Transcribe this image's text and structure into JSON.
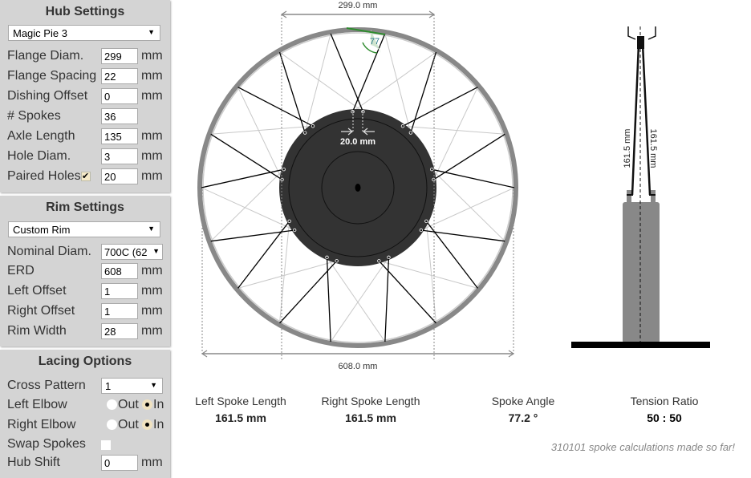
{
  "hub": {
    "title": "Hub Settings",
    "preset": "Magic Pie 3",
    "flange_diam_label": "Flange Diam.",
    "flange_diam": "299",
    "flange_spacing_label": "Flange Spacing",
    "flange_spacing": "22",
    "dishing_label": "Dishing Offset",
    "dishing": "0",
    "spokes_label": "# Spokes",
    "spokes": "36",
    "axle_label": "Axle Length",
    "axle": "135",
    "hole_label": "Hole Diam.",
    "hole": "3",
    "paired_label": "Paired Holes",
    "paired_checked": true,
    "paired": "20",
    "unit": "mm"
  },
  "rim": {
    "title": "Rim Settings",
    "preset": "Custom Rim",
    "nominal_label": "Nominal Diam.",
    "nominal": "700C (62",
    "erd_label": "ERD",
    "erd": "608",
    "left_label": "Left Offset",
    "left": "1",
    "right_label": "Right Offset",
    "right": "1",
    "width_label": "Rim Width",
    "width": "28",
    "unit": "mm"
  },
  "lacing": {
    "title": "Lacing Options",
    "cross_label": "Cross Pattern",
    "cross": "1",
    "left_elbow_label": "Left Elbow",
    "right_elbow_label": "Right Elbow",
    "out": "Out",
    "in": "In",
    "left_elbow": "In",
    "right_elbow": "In",
    "swap_label": "Swap Spokes",
    "swap_checked": false,
    "shift_label": "Hub Shift",
    "shift": "0",
    "unit": "mm"
  },
  "diagram": {
    "flange_dim": "299.0 mm",
    "erd_dim": "608.0 mm",
    "pair_dim": "20.0 mm",
    "angle": "77",
    "left_len": "161.5 mm",
    "right_len": "161.5 mm",
    "colors": {
      "rim": "#888888",
      "hub": "#333333",
      "front_spoke": "#000000",
      "back_spoke": "#c8c8c8",
      "angle": "#2e8b2e"
    }
  },
  "results": {
    "left_label": "Left Spoke Length",
    "left": "161.5 mm",
    "right_label": "Right Spoke Length",
    "right": "161.5 mm",
    "angle_label": "Spoke Angle",
    "angle": "77.2 °",
    "tension_label": "Tension Ratio",
    "tension": "50 : 50"
  },
  "footer": "310101 spoke calculations made so far!"
}
